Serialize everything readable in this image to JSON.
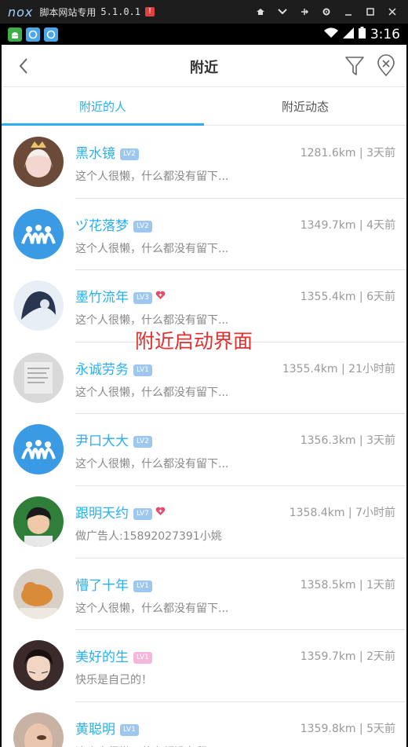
{
  "emulator": {
    "logo": "nox",
    "title": "脚本网站专用",
    "version": "5.1.0.1",
    "alert": "!",
    "controls": [
      "pin-icon",
      "chevron-down-icon",
      "dock-icon",
      "gear-icon",
      "minimize-icon",
      "maximize-icon",
      "close-icon"
    ]
  },
  "status_bar": {
    "time": "3:16",
    "notifications": [
      "android-icon",
      "app-icon",
      "app-icon"
    ]
  },
  "header": {
    "title": "附近",
    "back_icon": "chevron-left-icon",
    "filter_icon": "filter-icon",
    "clear_icon": "clear-location-icon"
  },
  "tabs": [
    {
      "label": "附近的人",
      "active": true
    },
    {
      "label": "附近动态",
      "active": false
    }
  ],
  "overlay_text": "附近启动界面",
  "colors": {
    "accent": "#29b0f0",
    "heart": "#e84a6a",
    "level": "#9ec7ef",
    "level_pink": "#f4b7dc"
  },
  "users": [
    {
      "name": "黑水镜",
      "level": "LV2",
      "heart": false,
      "meta": "1281.6km | 3天前",
      "bio": "这个人很懒，什么都没有留下..."
    },
    {
      "name": "ヅ花落梦",
      "level": "LV2",
      "heart": false,
      "meta": "1349.7km | 4天前",
      "bio": "这个人很懒，什么都没有留下..."
    },
    {
      "name": "墨竹流年",
      "level": "LV3",
      "heart": true,
      "meta": "1355.4km | 6天前",
      "bio": "这个人很懒，什么都没有留下..."
    },
    {
      "name": "永诚劳务",
      "level": "LV1",
      "heart": false,
      "meta": "1355.4km | 21小时前",
      "bio": "这个人很懒，什么都没有留下..."
    },
    {
      "name": "尹口大大",
      "level": "LV2",
      "heart": false,
      "meta": "1356.3km | 3天前",
      "bio": "这个人很懒，什么都没有留下..."
    },
    {
      "name": "跟明天约",
      "level": "LV7",
      "heart": true,
      "meta": "1358.4km | 7小时前",
      "bio": "做广告人:15892027391小姚"
    },
    {
      "name": "懵了十年",
      "level": "LV1",
      "heart": false,
      "meta": "1358.5km | 1天前",
      "bio": "这个人很懒，什么都没有留下..."
    },
    {
      "name": "美好的生",
      "level": "LV1",
      "heart": false,
      "pink": true,
      "meta": "1359.7km | 2天前",
      "bio": "快乐是自己的！"
    },
    {
      "name": "黄聪明",
      "level": "LV1",
      "heart": false,
      "meta": "1359.8km | 5天前",
      "bio": "这个人很懒，什么都没有留下..."
    }
  ]
}
